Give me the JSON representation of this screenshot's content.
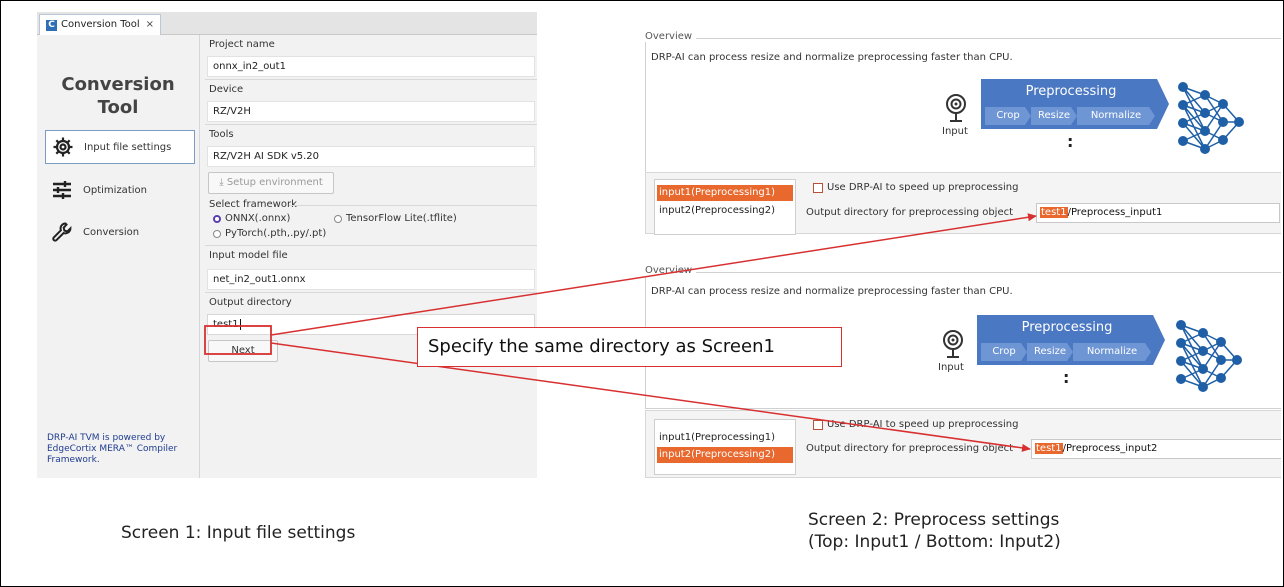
{
  "screen1": {
    "tab_label": "Conversion Tool",
    "tab_close": "×",
    "tab_logo": "C",
    "sidebar_title_line1": "Conversion",
    "sidebar_title_line2": "Tool",
    "nav": [
      {
        "label": "Input file settings",
        "icon": "gear-icon",
        "active": true
      },
      {
        "label": "Optimization",
        "icon": "sliders-icon",
        "active": false
      },
      {
        "label": "Conversion",
        "icon": "wrench-icon",
        "active": false
      }
    ],
    "footer": "DRP-AI TVM is powered by EdgeCortix MERA™ Compiler Framework.",
    "project_name_label": "Project name",
    "project_name_value": "onnx_in2_out1",
    "device_label": "Device",
    "device_value": "RZ/V2H",
    "tools_label": "Tools",
    "tools_value": "RZ/V2H AI SDK v5.20",
    "setup_button": "Setup environment",
    "framework_label": "Select framework",
    "frameworks": [
      "ONNX(.onnx)",
      "TensorFlow Lite(.tflite)",
      "PyTorch(.pth,.py/.pt)"
    ],
    "framework_selected": "ONNX(.onnx)",
    "model_file_label": "Input model file",
    "model_file_value": "net_in2_out1.onnx",
    "output_dir_label": "Output directory",
    "output_dir_value": "test1",
    "next_button": "Next"
  },
  "screen2": {
    "overview_title": "Overview",
    "overview_desc": "DRP-AI can process resize and normalize preprocessing faster than CPU.",
    "diagram_title": "Preprocessing",
    "diagram_steps": [
      "Crop",
      "Resize",
      "Normalize"
    ],
    "input_label": "Input",
    "ellipsis": ":",
    "inputs": [
      "input1(Preprocessing1)",
      "input2(Preprocessing2)"
    ],
    "use_drpai_label": "Use DRP-AI to speed up preprocessing",
    "output_object_label": "Output directory for preprocessing object",
    "top": {
      "selected_input": "input1(Preprocessing1)",
      "output_dir_prefix": "test1",
      "output_dir_suffix": "/Preprocess_input1"
    },
    "bottom": {
      "selected_input": "input2(Preprocessing2)",
      "output_dir_prefix": "test1",
      "output_dir_suffix": "/Preprocess_input2"
    }
  },
  "callout": "Specify the same directory as Screen1",
  "captions": {
    "screen1": "Screen 1: Input file settings",
    "screen2_line1": "Screen 2: Preprocess settings",
    "screen2_line2": "(Top: Input1 / Bottom: Input2)"
  },
  "colors": {
    "accent_orange": "#e8682e",
    "diagram_blue": "#4a78c2",
    "network_blue": "#1f5fa6",
    "annotation_red": "#d83030"
  }
}
